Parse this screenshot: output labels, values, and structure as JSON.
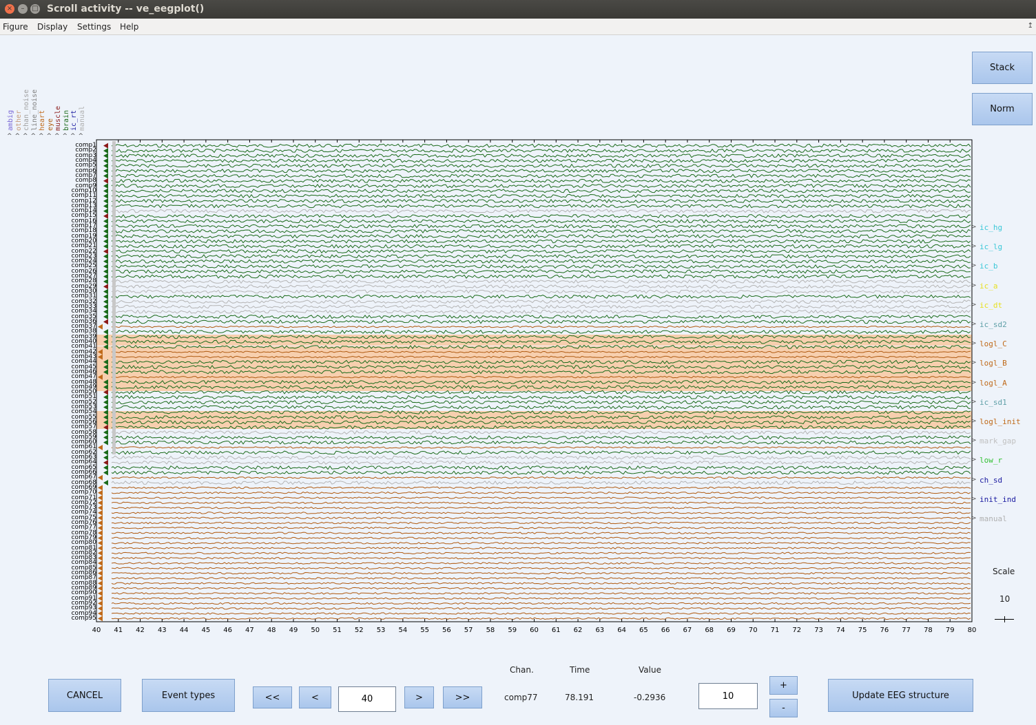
{
  "window": {
    "title": "Scroll activity -- ve_eegplot()"
  },
  "menu": [
    "Figure",
    "Display",
    "Settings",
    "Help"
  ],
  "side_buttons": {
    "stack": "Stack",
    "norm": "Norm"
  },
  "classes": [
    {
      "name": "ambig",
      "color": "#7b69d6"
    },
    {
      "name": "other",
      "color": "#c79b7a"
    },
    {
      "name": "chan_noise",
      "color": "#a0a0a0"
    },
    {
      "name": "line_noise",
      "color": "#808080"
    },
    {
      "name": "heart",
      "color": "#c06a1a"
    },
    {
      "name": "eye",
      "color": "#b06010"
    },
    {
      "name": "muscle",
      "color": "#8b1a1a"
    },
    {
      "name": "brain",
      "color": "#1a6a1a"
    },
    {
      "name": "ic_rt",
      "color": "#1a1aa0"
    },
    {
      "name": "manual",
      "color": "#b0b0b0"
    }
  ],
  "right_labels": [
    {
      "text": "ic_hg",
      "color": "#3cc8d8"
    },
    {
      "text": "ic_lg",
      "color": "#3cc8d8"
    },
    {
      "text": "ic_b",
      "color": "#3cc8d8"
    },
    {
      "text": "ic_a",
      "color": "#e8e020"
    },
    {
      "text": "ic_dt",
      "color": "#e8e020"
    },
    {
      "text": "ic_sd2",
      "color": "#60a0a8"
    },
    {
      "text": "logl_C",
      "color": "#c06a1a"
    },
    {
      "text": "logl_B",
      "color": "#c06a1a"
    },
    {
      "text": "logl_A",
      "color": "#c06a1a"
    },
    {
      "text": "ic_sd1",
      "color": "#60a0a8"
    },
    {
      "text": "logl_init",
      "color": "#c06a1a"
    },
    {
      "text": "mark_gap",
      "color": "#c0c0c0"
    },
    {
      "text": "low_r",
      "color": "#30c030"
    },
    {
      "text": "ch_sd",
      "color": "#1a1aa0"
    },
    {
      "text": "init_ind",
      "color": "#1a1aa0"
    },
    {
      "text": "manual",
      "color": "#b0b0b0"
    }
  ],
  "channels_prefix": "comp",
  "channel_count": 95,
  "channel_colors": "gggggggggggggigggggggggggggiiigiiiggoggggoogggoggggggggggiggogiiggoioooooooooooooooooooooooooooooo",
  "time_axis": {
    "start": 40,
    "end": 80
  },
  "scale": {
    "label": "Scale",
    "value": "10"
  },
  "readout": {
    "chan_label": "Chan.",
    "time_label": "Time",
    "value_label": "Value",
    "chan": "comp77",
    "time": "78.191",
    "value": "-0.2936"
  },
  "controls": {
    "cancel": "CANCEL",
    "event_types": "Event types",
    "first": "<<",
    "prev": "<",
    "position": "40",
    "next": ">",
    "last": ">>",
    "spacing": "10",
    "plus": "+",
    "minus": "-",
    "update": "Update EEG structure"
  },
  "colors": {
    "brain": "#1a6a1a",
    "eye": "#b05a10",
    "gray": "#b4b4b4",
    "highlight": "#f8c8a0",
    "button": "#aec8ef"
  }
}
